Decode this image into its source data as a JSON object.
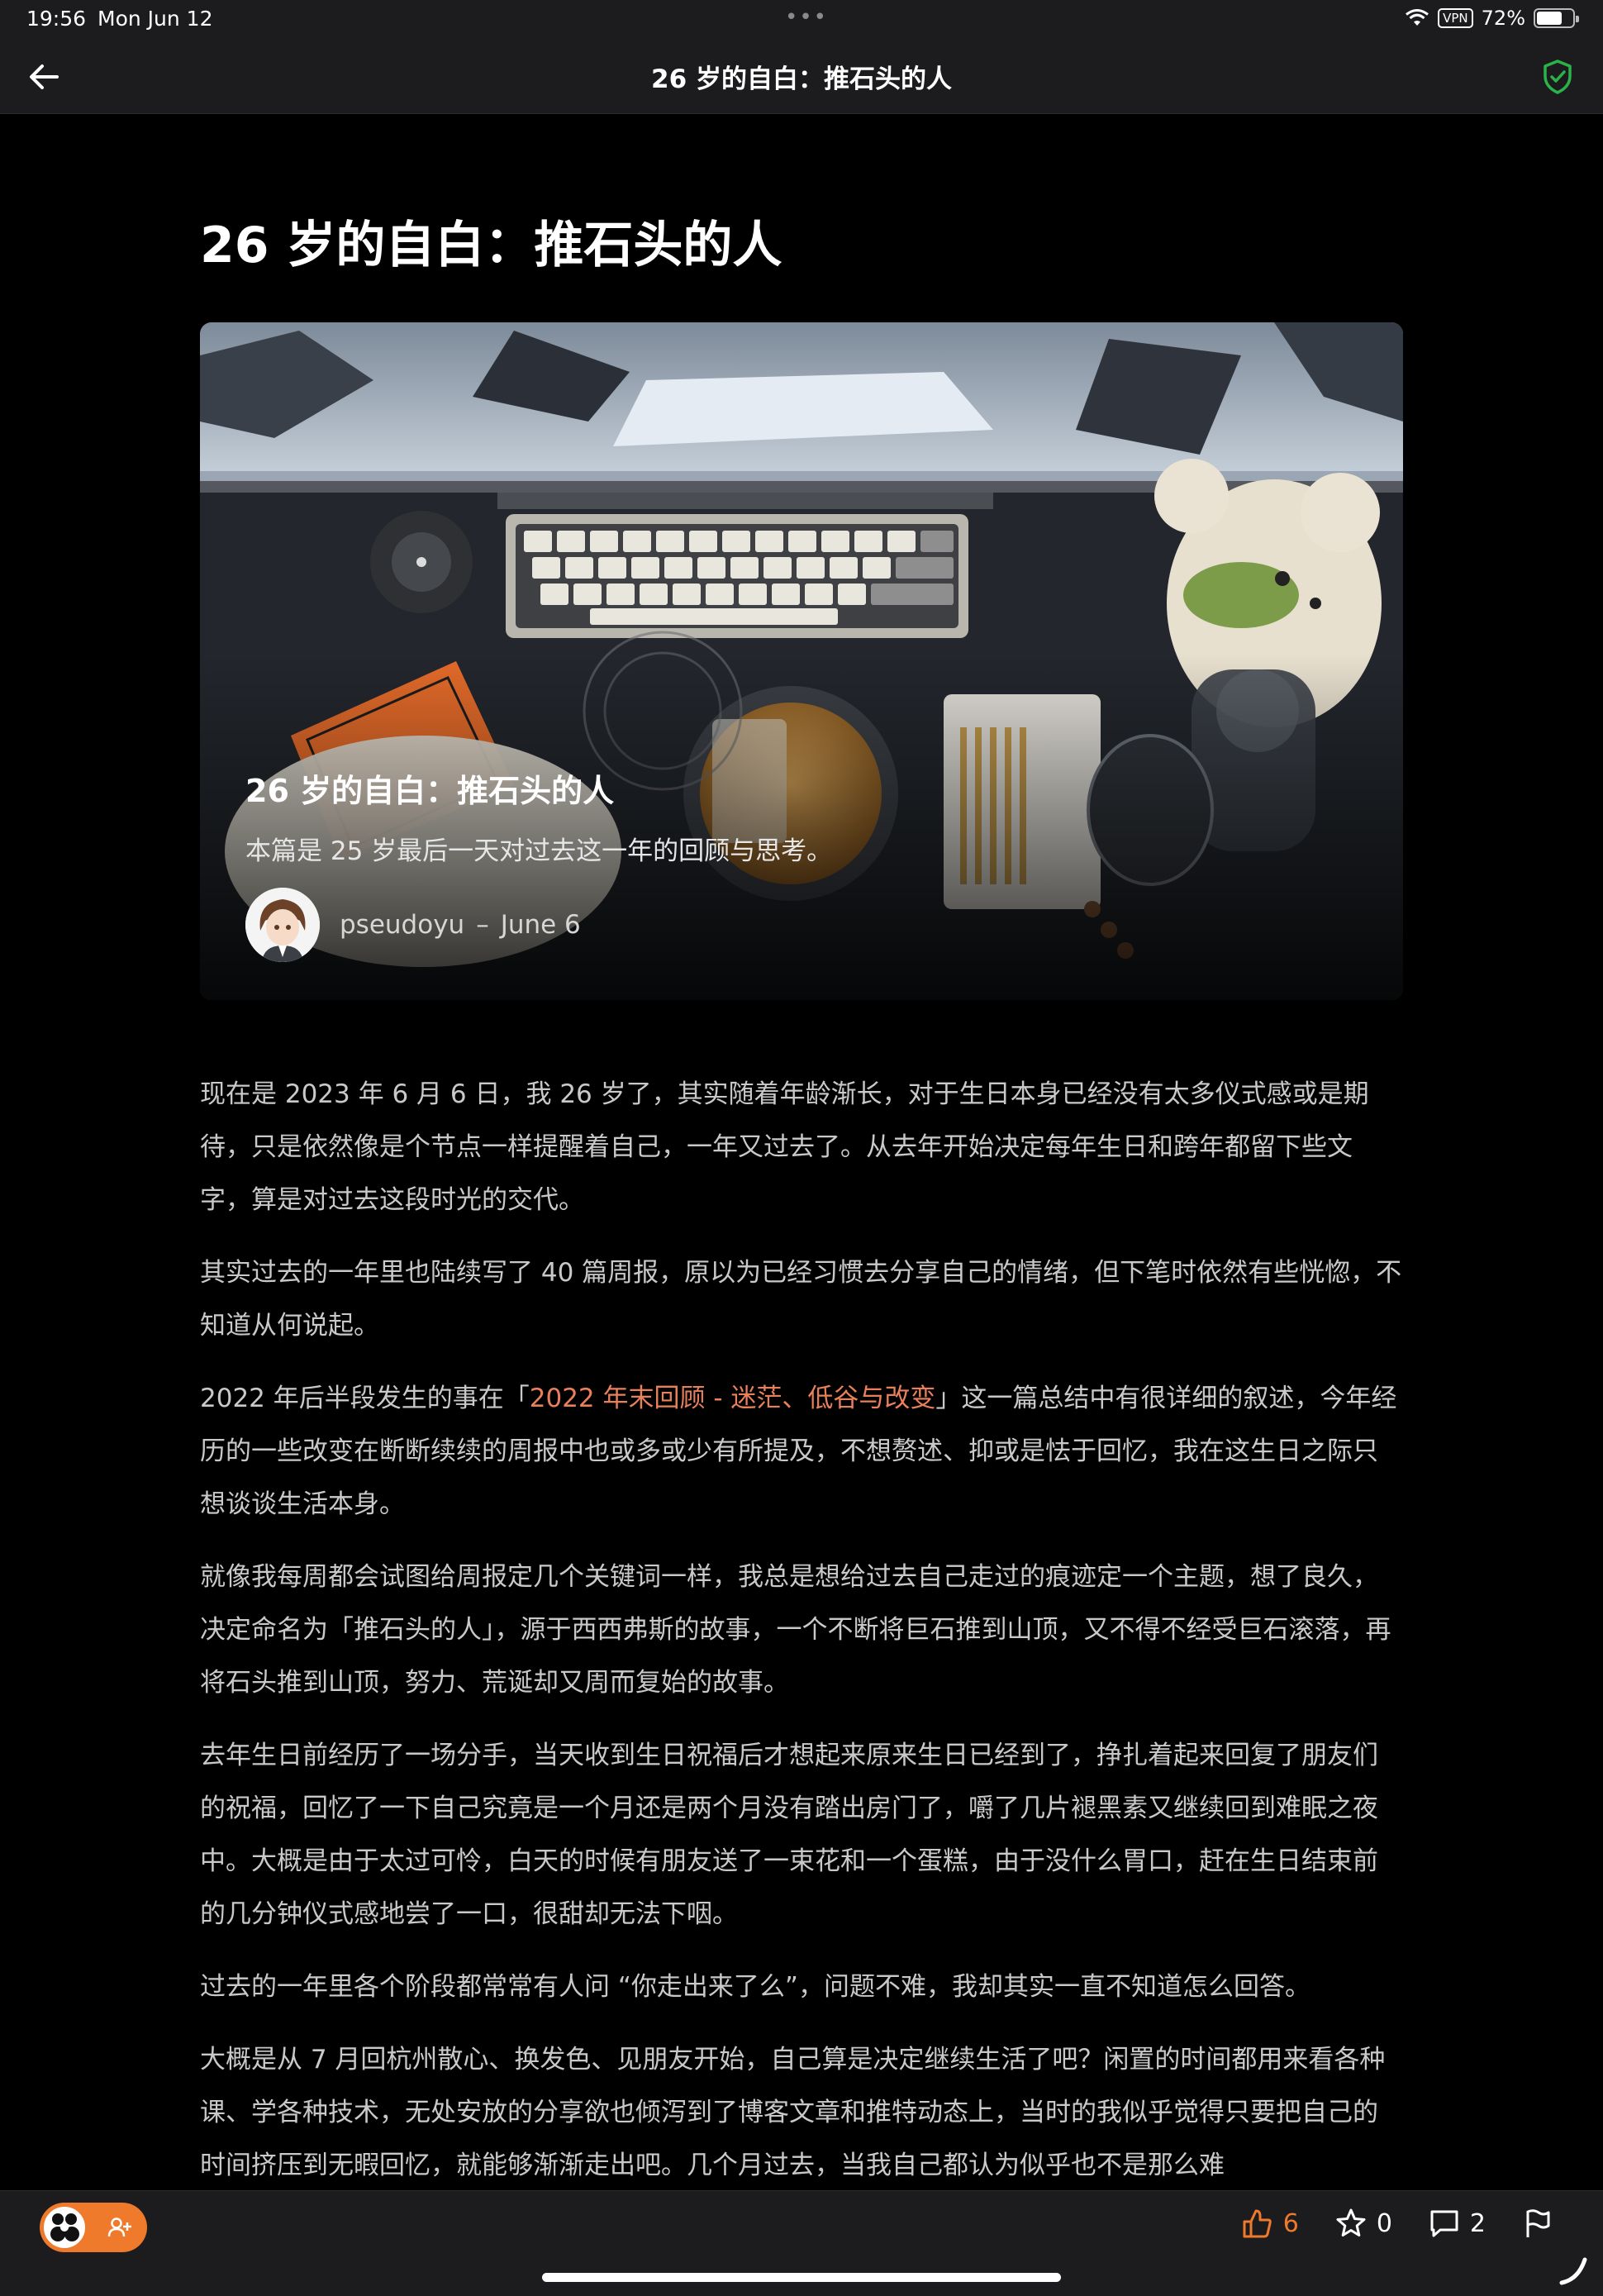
{
  "status_bar": {
    "time": "19:56",
    "date": "Mon Jun 12",
    "vpn": "VPN",
    "battery": "72%",
    "battery_level": 0.72
  },
  "nav": {
    "title": "26 岁的自白：推石头的人",
    "back_icon": "arrow-left-icon",
    "shield_icon": "shield-check-icon",
    "shield_color": "#2bb34a"
  },
  "article": {
    "title": "26 岁的自白：推石头的人",
    "hero": {
      "title": "26 岁的自白：推石头的人",
      "subtitle": "本篇是 25 岁最后一天对过去这一年的回顾与思考。",
      "author": "pseudoyu",
      "separator": "–",
      "date": "June 6"
    },
    "paragraphs": {
      "p1": "现在是 2023 年 6 月 6 日，我 26 岁了，其实随着年龄渐长，对于生日本身已经没有太多仪式感或是期待，只是依然像是个节点一样提醒着自己，一年又过去了。从去年开始决定每年生日和跨年都留下些文字，算是对过去这段时光的交代。",
      "p2": "其实过去的一年里也陆续写了 40 篇周报，原以为已经习惯去分享自己的情绪，但下笔时依然有些恍惚，不知道从何说起。",
      "p3_before": "2022 年后半段发生的事在「",
      "p3_link": "2022 年末回顾 - 迷茫、低谷与改变",
      "p3_after": "」这一篇总结中有很详细的叙述，今年经历的一些改变在断断续续的周报中也或多或少有所提及，不想赘述、抑或是怯于回忆，我在这生日之际只想谈谈生活本身。",
      "p4": "就像我每周都会试图给周报定几个关键词一样，我总是想给过去自己走过的痕迹定一个主题，想了良久，决定命名为「推石头的人」，源于西西弗斯的故事，一个不断将巨石推到山顶，又不得不经受巨石滚落，再将石头推到山顶，努力、荒诞却又周而复始的故事。",
      "p5": "去年生日前经历了一场分手，当天收到生日祝福后才想起来原来生日已经到了，挣扎着起来回复了朋友们的祝福，回忆了一下自己究竟是一个月还是两个月没有踏出房门了，嚼了几片褪黑素又继续回到难眠之夜中。大概是由于太过可怜，白天的时候有朋友送了一束花和一个蛋糕，由于没什么胃口，赶在生日结束前的几分钟仪式感地尝了一口，很甜却无法下咽。",
      "p6": "过去的一年里各个阶段都常常有人问 “你走出来了么”，问题不难，我却其实一直不知道怎么回答。",
      "p7": "大概是从 7 月回杭州散心、换发色、见朋友开始，自己算是决定继续生活了吧？闲置的时间都用来看各种课、学各种技术，无处安放的分享欲也倾泻到了博客文章和推特动态上，当时的我似乎觉得只要把自己的时间挤压到无暇回忆，就能够渐渐走出吧。几个月过去，当我自己都认为似乎也不是那么难"
    }
  },
  "bottom_bar": {
    "like_count": "6",
    "star_count": "0",
    "comment_count": "2",
    "accent_color": "#f07a2b"
  }
}
